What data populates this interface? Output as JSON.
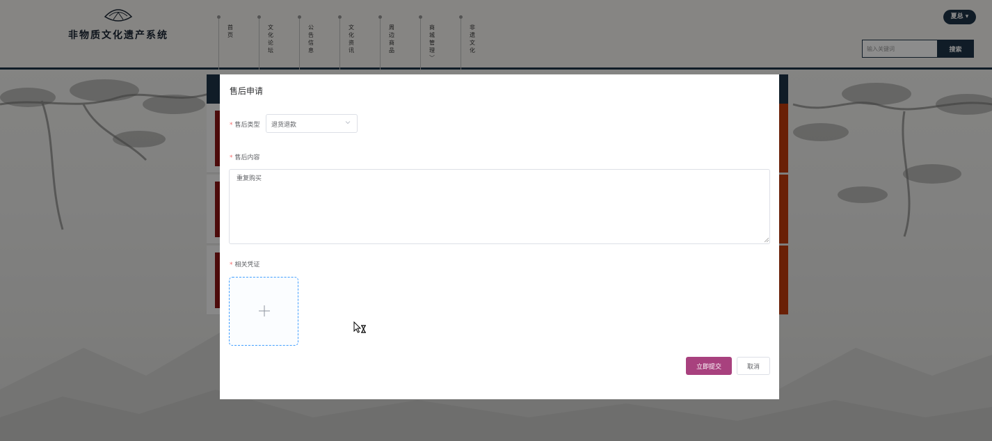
{
  "header": {
    "site_title": "非物质文化遗产系统",
    "nav": [
      {
        "label": "首页",
        "has_dropdown": false
      },
      {
        "label": "文化论坛",
        "has_dropdown": false
      },
      {
        "label": "公告信息",
        "has_dropdown": false
      },
      {
        "label": "文化资讯",
        "has_dropdown": false
      },
      {
        "label": "周边商品",
        "has_dropdown": false
      },
      {
        "label": "商城管理",
        "has_dropdown": true
      },
      {
        "label": "非遗文化",
        "has_dropdown": false
      }
    ],
    "nav_caret": "﹀",
    "user_menu": "夏总 ▾",
    "search_placeholder": "输入关键词",
    "search_button": "搜索"
  },
  "modal": {
    "title": "售后申请",
    "type_field": {
      "label": "售后类型",
      "required": true,
      "value": "退货退款"
    },
    "content_field": {
      "label": "售后内容",
      "required": true,
      "value": "重复购买"
    },
    "evidence_field": {
      "label": "相关凭证",
      "required": true
    },
    "submit_button": "立即提交",
    "cancel_button": "取消"
  },
  "colors": {
    "header_dark": "#1e3347",
    "submit_accent": "#a8417e",
    "required_mark": "#f56c6c",
    "upload_border": "#409eff",
    "card_side": "#c23b0c"
  },
  "icons": {
    "logo": "fan-logo-icon",
    "select_arrow": "chevron-down-icon",
    "upload": "plus-icon",
    "cursor": "busy-cursor-icon"
  }
}
